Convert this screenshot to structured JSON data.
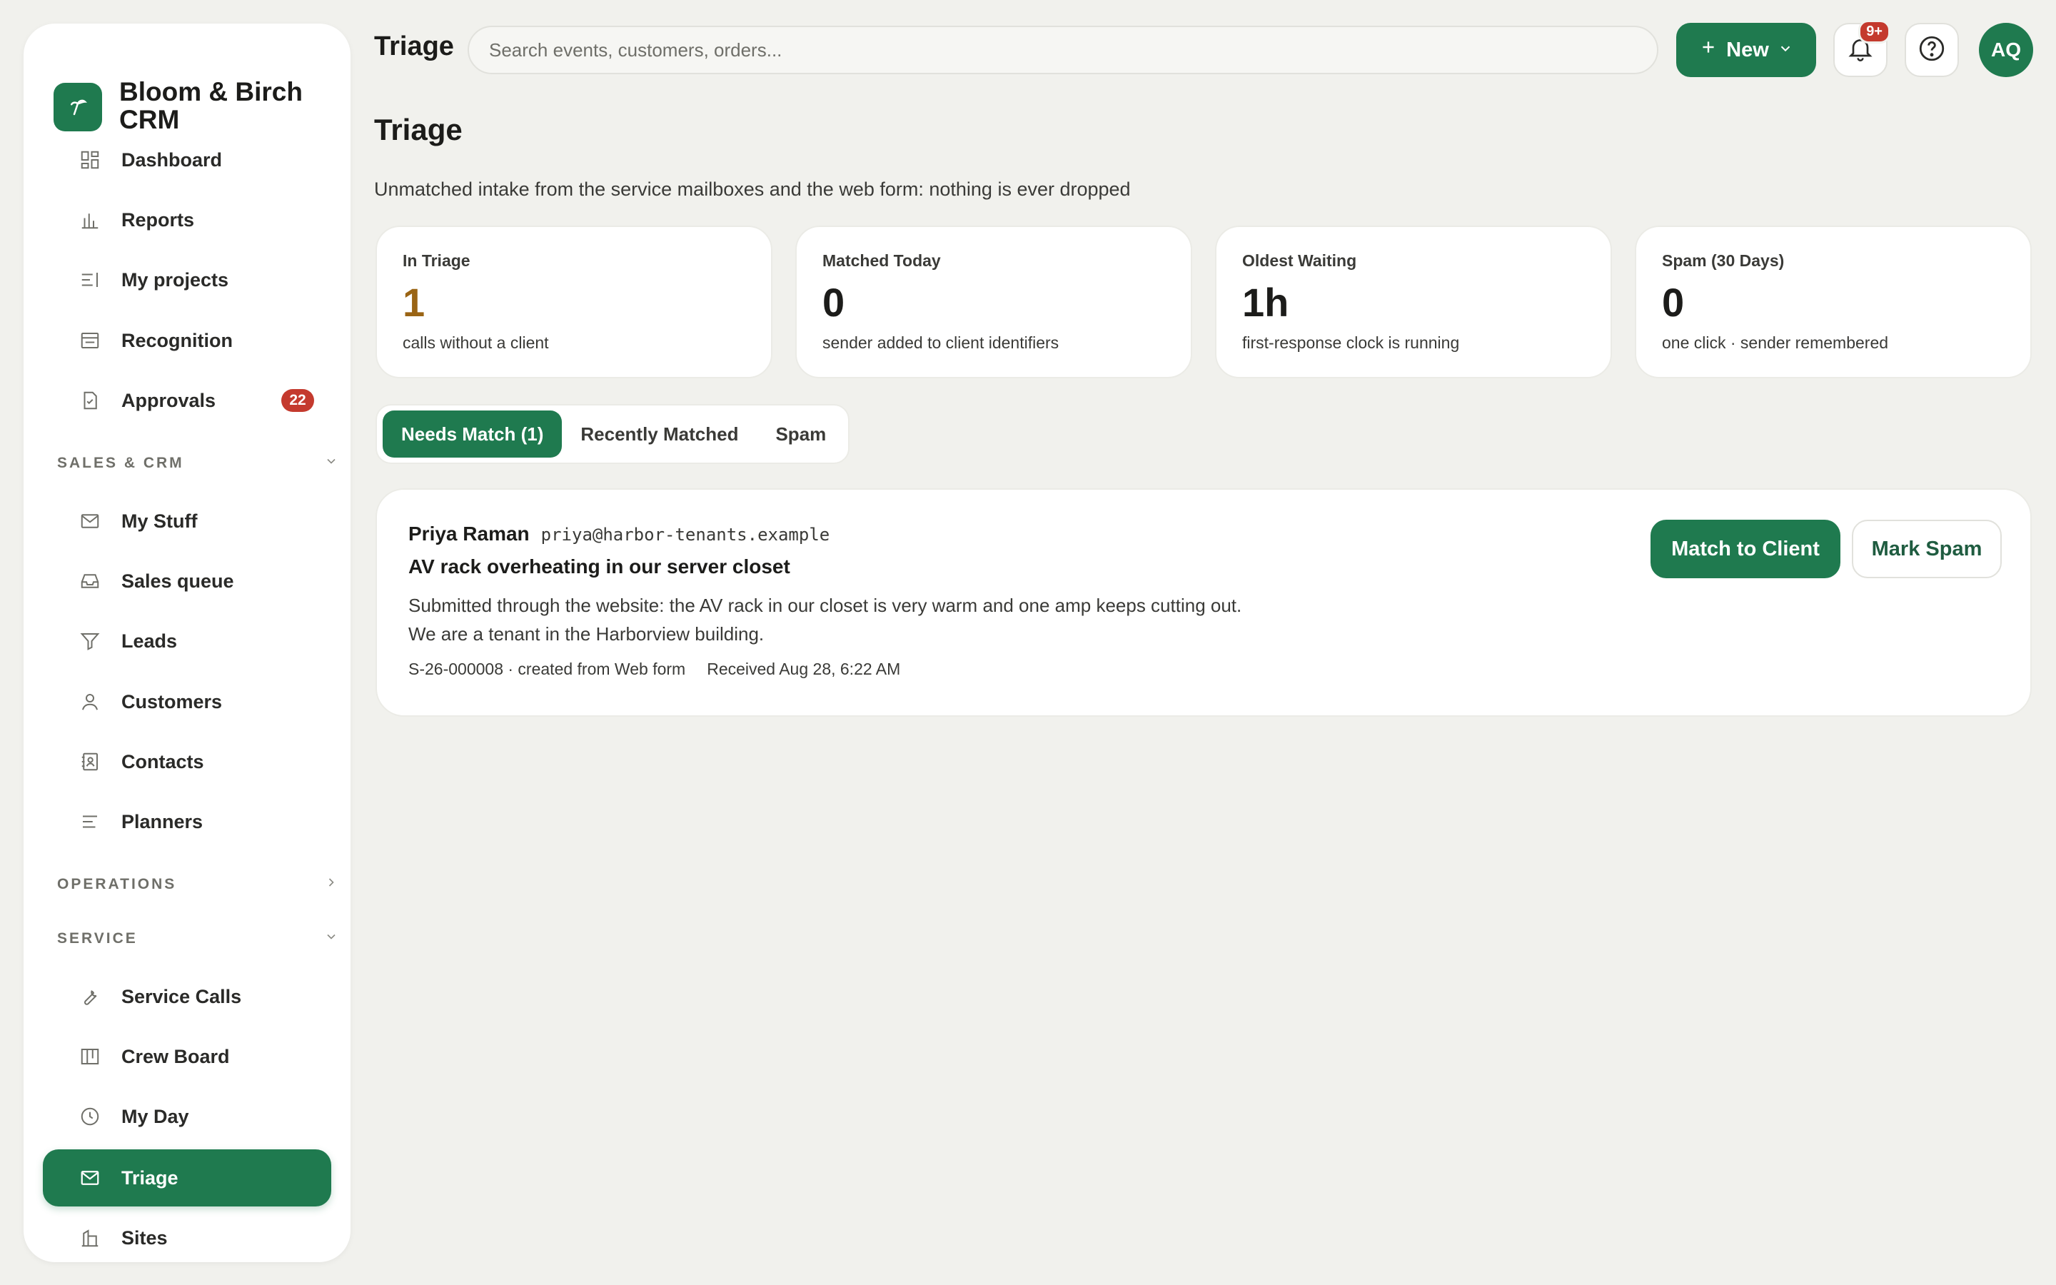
{
  "app": {
    "brand": "Bloom & Birch CRM",
    "page_header": "Triage"
  },
  "search": {
    "placeholder": "Search events, customers, orders..."
  },
  "header": {
    "new_label": "New",
    "notif_badge": "9+",
    "avatar_initials": "AQ"
  },
  "sidebar": {
    "items": [
      {
        "label": "Dashboard",
        "icon": "dashboard-icon"
      },
      {
        "label": "Reports",
        "icon": "bar-chart-icon"
      },
      {
        "label": "My projects",
        "icon": "projects-icon"
      },
      {
        "label": "Recognition",
        "icon": "recognition-icon"
      },
      {
        "label": "Approvals",
        "icon": "approvals-icon",
        "badge": "22"
      }
    ],
    "sections": [
      {
        "label": "SALES & CRM",
        "expanded": true
      },
      {
        "label": "OPERATIONS",
        "expanded": false
      },
      {
        "label": "SERVICE",
        "expanded": true
      }
    ],
    "sales_items": [
      {
        "label": "My Stuff",
        "icon": "mail-icon"
      },
      {
        "label": "Sales queue",
        "icon": "inbox-icon"
      },
      {
        "label": "Leads",
        "icon": "filter-icon"
      },
      {
        "label": "Customers",
        "icon": "user-icon"
      },
      {
        "label": "Contacts",
        "icon": "contacts-icon"
      },
      {
        "label": "Planners",
        "icon": "planners-icon"
      }
    ],
    "service_items": [
      {
        "label": "Service Calls",
        "icon": "wrench-icon"
      },
      {
        "label": "Crew Board",
        "icon": "board-icon"
      },
      {
        "label": "My Day",
        "icon": "clock-icon"
      },
      {
        "label": "Triage",
        "icon": "mail-icon",
        "active": true
      },
      {
        "label": "Sites",
        "icon": "building-icon"
      }
    ]
  },
  "main": {
    "title": "Triage",
    "subtitle": "Unmatched intake from the service mailboxes and the web form: nothing is ever dropped",
    "stats": [
      {
        "label": "In Triage",
        "value": "1",
        "note": "calls without a client",
        "color": "#9a6414"
      },
      {
        "label": "Matched Today",
        "value": "0",
        "note": "sender added to client identifiers",
        "color": "#1c1c1a"
      },
      {
        "label": "Oldest Waiting",
        "value": "1h",
        "note": "first-response clock is running",
        "color": "#1c1c1a"
      },
      {
        "label": "Spam (30 Days)",
        "value": "0",
        "note": "one click · sender remembered",
        "color": "#1c1c1a"
      }
    ],
    "tabs": [
      {
        "label": "Needs Match (1)",
        "active": true
      },
      {
        "label": "Recently Matched",
        "active": false
      },
      {
        "label": "Spam",
        "active": false
      }
    ],
    "item": {
      "sender_name": "Priya Raman",
      "sender_email": "priya@harbor-tenants.example",
      "subject": "AV rack overheating in our server closet",
      "body_line1": "Submitted through the website: the AV rack in our closet is very warm and one amp keeps cutting out.",
      "body_line2": "We are a tenant in the Harborview building.",
      "ref": "S-26-000008 · created from Web form",
      "received": "Received Aug 28, 6:22 AM",
      "match_label": "Match to Client",
      "spam_label": "Mark Spam"
    }
  },
  "colors": {
    "accent": "#1f7a4f",
    "badge": "#c43a2e",
    "background": "#f1f1ed"
  }
}
